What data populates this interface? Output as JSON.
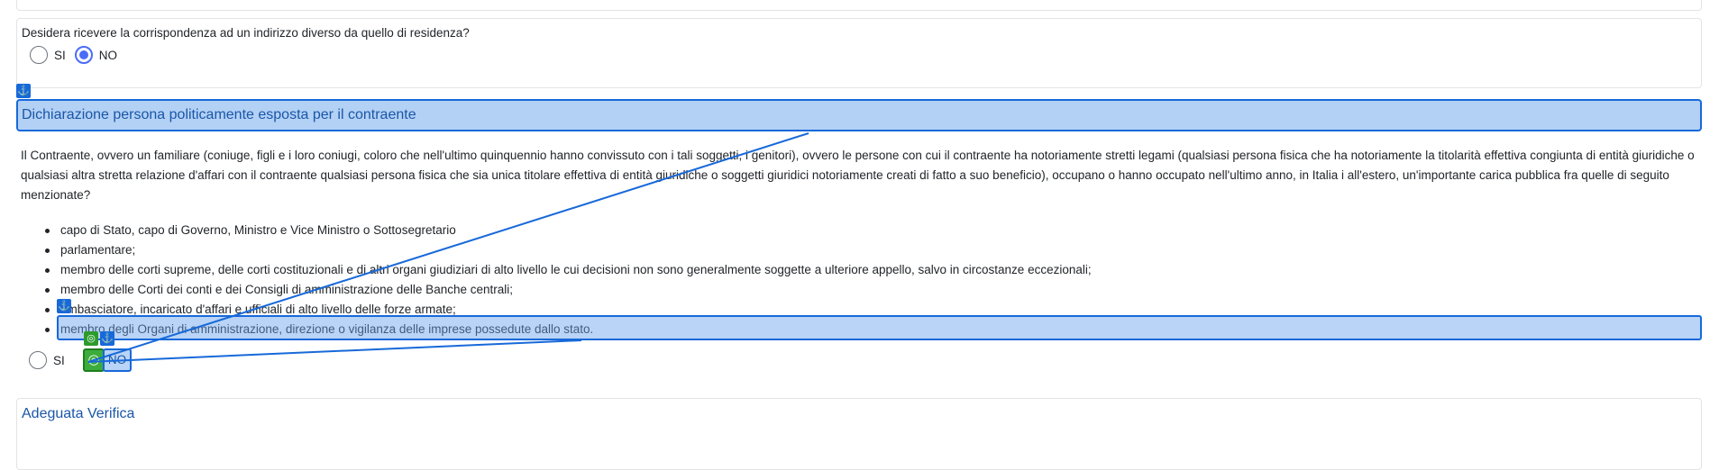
{
  "question": {
    "text": "Desidera ricevere la corrispondenza ad un indirizzo diverso da quello di residenza?",
    "options": [
      {
        "label": "SI",
        "checked": false
      },
      {
        "label": "NO",
        "checked": true
      }
    ]
  },
  "pep_section": {
    "title": "Dichiarazione persona politicamente esposta per il contraente",
    "paragraph": "Il Contraente, ovvero un familiare (coniuge, figli e i loro coniugi, coloro che nell'ultimo quinquennio hanno convissuto con i tali soggetti, i genitori), ovvero le persone con cui il contraente ha notoriamente stretti legami (qualsiasi persona fisica che ha notoriamente la titolarità effettiva congiunta di entità giuridiche o qualsiasi altra stretta relazione d'affari con il contraente qualsiasi persona fisica che sia unica titolare effettiva di entità giuridiche o soggetti giuridici notoriamente creati di fatto a suo beneficio), occupano o hanno occupato nell'ultimo anno, in Italia i all'estero, un'importante carica pubblica fra quelle di seguito menzionate?",
    "bullets": [
      "capo di Stato, capo di Governo, Ministro e Vice Ministro o Sottosegretario",
      "parlamentare;",
      "membro delle corti supreme, delle corti costituzionali e di altri organi giudiziari di alto livello le cui decisioni non sono generalmente soggette a ulteriore appello, salvo in circostanze eccezionali;",
      "membro delle Corti dei conti e dei Consigli di amministrazione delle Banche centrali;",
      "ambasciatore, incaricato d'affari e ufficiali di alto livello delle forze armate;",
      "membro degli Organi di amministrazione, direzione o vigilanza delle imprese possedute dallo stato."
    ],
    "options": [
      {
        "label": "SI",
        "checked": false
      },
      {
        "label": "NO",
        "checked": false
      }
    ]
  },
  "verifica_section": {
    "title": "Adeguata Verifica"
  },
  "overlay": {
    "anchor_icon": "anchor-icon",
    "target_icon": "target-icon",
    "anchor_glyph": "⚓",
    "target_glyph": "◎",
    "highlight_color": "#1769d9",
    "target_color": "#2c9b2c"
  }
}
